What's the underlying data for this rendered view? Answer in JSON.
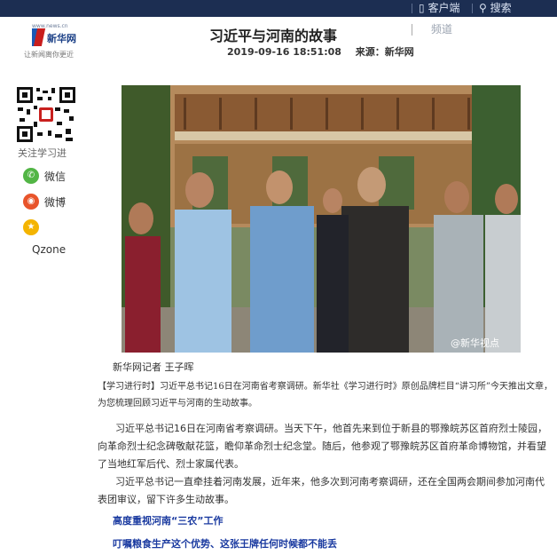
{
  "topbar": {
    "client_label": "客户端",
    "search_label": "搜索"
  },
  "logo": {
    "mark_small": "www.news.cn",
    "brand": "新华网",
    "slogan": "让新闻离你更近"
  },
  "article": {
    "title": "习近平与河南的故事",
    "channel": "频道",
    "datetime": "2019-09-16 18:51:08",
    "source": "来源：新华网",
    "photo_credit": "@新华视点",
    "author": "新华网记者 王子晖",
    "lead": "【学习进行时】习近平总书记16日在河南省考察调研。新华社《学习进行时》原创品牌栏目“讲习所”今天推出文章，为您梳理回顾习近平与河南的生动故事。",
    "paragraphs": [
      "习近平总书记16日在河南省考察调研。当天下午，他首先来到位于新县的鄂豫皖苏区首府烈士陵园，向革命烈士纪念碑敬献花篮，瞻仰革命烈士纪念堂。随后，他参观了鄂豫皖苏区首府革命博物馆，并看望了当地红军后代、烈士家属代表。",
      "习近平总书记一直牵挂着河南发展，近年来，他多次到河南考察调研，还在全国两会期间参加河南代表团审议，留下许多生动故事。"
    ],
    "subheads": [
      "高度重视河南“三农”工作",
      "叮嘱粮食生产这个优势、这张王牌任何时候都不能丢"
    ]
  },
  "sidebar": {
    "qr_caption": "关注学习进",
    "share": [
      {
        "label": "微信",
        "icon": "wechat-icon",
        "color": "#52b545"
      },
      {
        "label": "微博",
        "icon": "weibo-icon",
        "color": "#e8542b"
      },
      {
        "label": "",
        "icon": "qzone-icon",
        "color": "#f4b400"
      }
    ],
    "qzone_label": "Qzone"
  }
}
